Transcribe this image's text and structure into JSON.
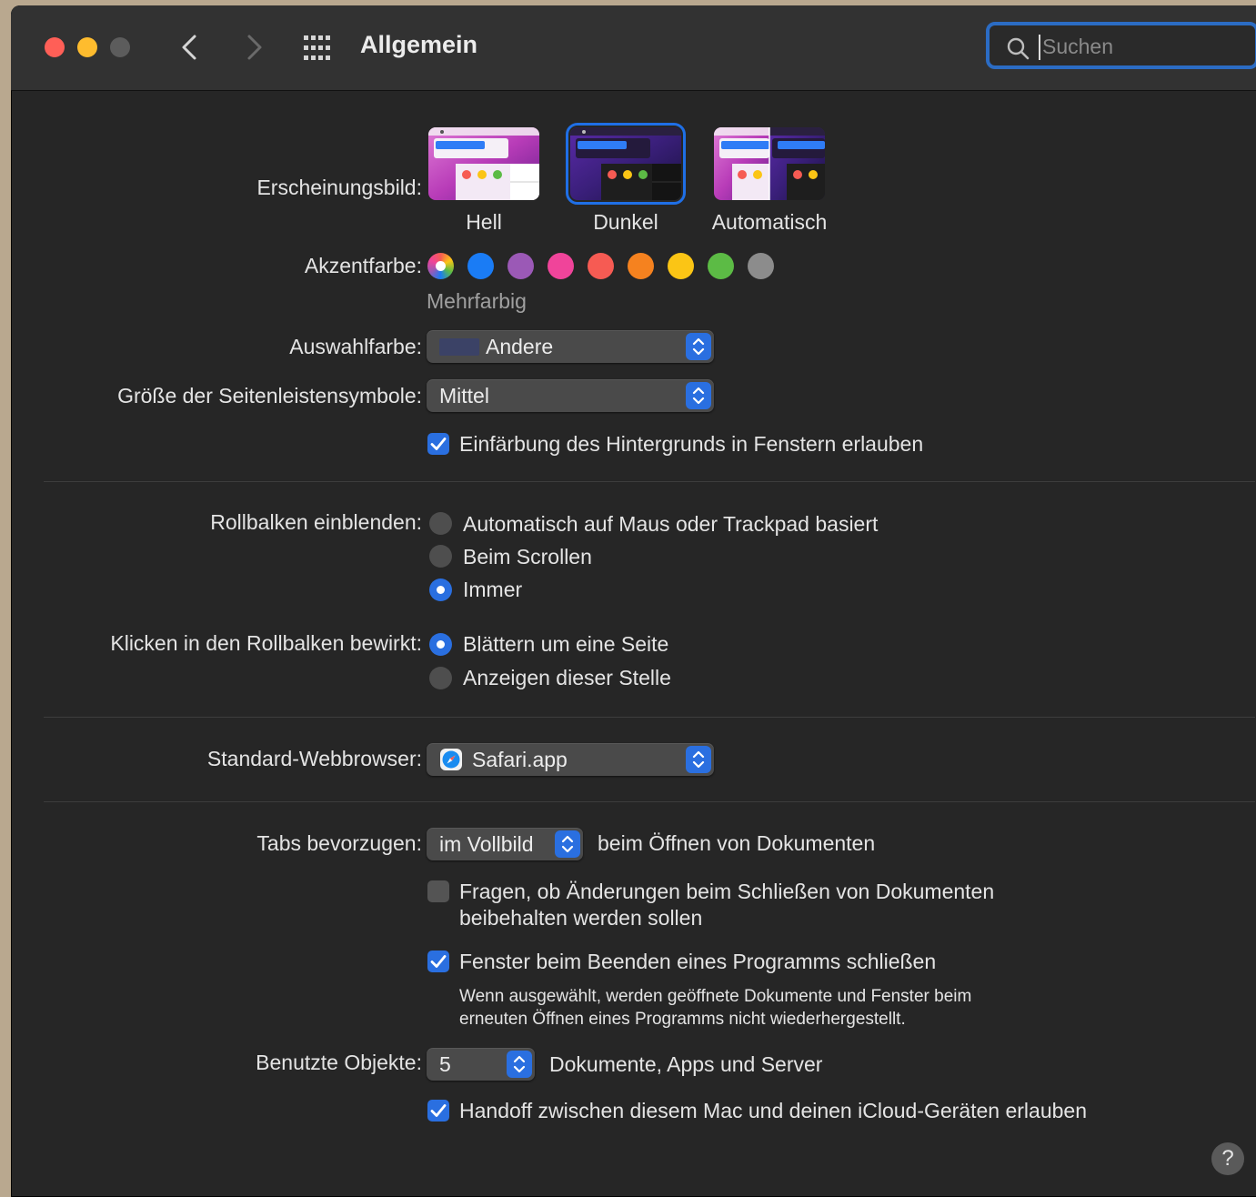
{
  "window": {
    "title": "Allgemein"
  },
  "search": {
    "placeholder": "Suchen"
  },
  "appearance": {
    "label": "Erscheinungsbild:",
    "options": [
      {
        "name": "Hell",
        "selected": false
      },
      {
        "name": "Dunkel",
        "selected": true
      },
      {
        "name": "Automatisch",
        "selected": false
      }
    ]
  },
  "accent": {
    "label": "Akzentfarbe:",
    "selected_name": "Mehrfarbig",
    "colors": [
      "multicolor",
      "#1a7cf5",
      "#9b59b6",
      "#f0449a",
      "#f65b53",
      "#f5821f",
      "#fbc515",
      "#5cbb45",
      "#8c8c8c"
    ]
  },
  "highlight": {
    "label": "Auswahlfarbe:",
    "value": "Andere",
    "swatch": "#3b4266"
  },
  "sidebar_size": {
    "label": "Größe der Seitenleistensymbole:",
    "value": "Mittel"
  },
  "tinting": {
    "label": "Einfärbung des Hintergrunds in Fenstern erlauben",
    "checked": true
  },
  "scrollbars": {
    "label": "Rollbalken einblenden:",
    "options": [
      {
        "text": "Automatisch auf Maus oder Trackpad basiert",
        "selected": false
      },
      {
        "text": "Beim Scrollen",
        "selected": false
      },
      {
        "text": "Immer",
        "selected": true
      }
    ]
  },
  "click_scroll": {
    "label": "Klicken in den Rollbalken bewirkt:",
    "options": [
      {
        "text": "Blättern um eine Seite",
        "selected": true
      },
      {
        "text": "Anzeigen dieser Stelle",
        "selected": false
      }
    ]
  },
  "browser": {
    "label": "Standard-Webbrowser:",
    "value": "Safari.app"
  },
  "tabs": {
    "label": "Tabs bevorzugen:",
    "value": "im Vollbild",
    "suffix": "beim Öffnen von Dokumenten"
  },
  "ask_changes": {
    "line1": "Fragen, ob Änderungen beim Schließen von Dokumenten",
    "line2": "beibehalten werden sollen",
    "checked": false
  },
  "close_windows": {
    "label": "Fenster beim Beenden eines Programms schließen",
    "checked": true,
    "note_line1": "Wenn ausgewählt, werden geöffnete Dokumente und Fenster beim",
    "note_line2": "erneuten Öffnen eines Programms nicht wiederhergestellt."
  },
  "recent": {
    "label": "Benutzte Objekte:",
    "value": "5",
    "suffix": "Dokumente, Apps und Server"
  },
  "handoff": {
    "label": "Handoff zwischen diesem Mac und deinen iCloud-Geräten erlauben",
    "checked": true
  },
  "help": {
    "label": "?"
  }
}
